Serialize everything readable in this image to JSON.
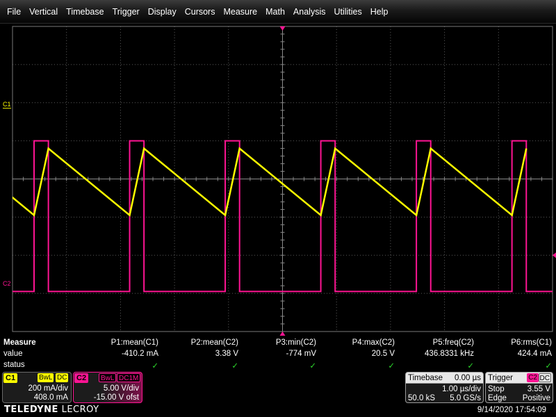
{
  "menu": [
    "File",
    "Vertical",
    "Timebase",
    "Trigger",
    "Display",
    "Cursors",
    "Measure",
    "Math",
    "Analysis",
    "Utilities",
    "Help"
  ],
  "colors": {
    "ch1": "#ffff00",
    "ch2": "#ff1493",
    "grid": "#5a5a5a",
    "check": "#2bd62b"
  },
  "markers": {
    "ch1": "C1",
    "ch2": "C2"
  },
  "measure": {
    "title": "Measure",
    "row_value": "value",
    "row_status": "status",
    "params": [
      {
        "name": "P1:mean(C1)",
        "value": "-410.2 mA",
        "status": "✓"
      },
      {
        "name": "P2:mean(C2)",
        "value": "3.38 V",
        "status": "✓"
      },
      {
        "name": "P3:min(C2)",
        "value": "-774 mV",
        "status": "✓"
      },
      {
        "name": "P4:max(C2)",
        "value": "20.5 V",
        "status": "✓"
      },
      {
        "name": "P5:freq(C2)",
        "value": "436.8331 kHz",
        "status": "✓"
      },
      {
        "name": "P6:rms(C1)",
        "value": "424.4 mA",
        "status": "✓"
      }
    ]
  },
  "ch1": {
    "label": "C1",
    "bw": "BwL",
    "coupling": "DC",
    "vdiv": "200 mA/div",
    "offset": "408.0 mA"
  },
  "ch2": {
    "label": "C2",
    "bw": "BwL",
    "coupling": "DC1M",
    "vdiv": "5.00 V/div",
    "offset": "-15.00 V ofst"
  },
  "timebase": {
    "title": "Timebase",
    "delay": "0.00 µs",
    "tdiv": "1.00 µs/div",
    "samples": "50.0 kS",
    "rate": "5.0 GS/s"
  },
  "trigger": {
    "title": "Trigger",
    "source": "C2",
    "coupling": "DC",
    "mode": "Stop",
    "level": "3.55 V",
    "type": "Edge",
    "slope": "Positive"
  },
  "brand": {
    "part1": "TELEDYNE",
    "part2": " LECROY"
  },
  "datetime": "9/14/2020 17:54:09",
  "waveform": {
    "period_div": 1.77,
    "ch1_trough_div": -0.95,
    "ch1_peak_div": 0.8,
    "ch2_high_div": 1.0,
    "ch2_low_div": -2.95,
    "high_fraction": 0.15
  }
}
